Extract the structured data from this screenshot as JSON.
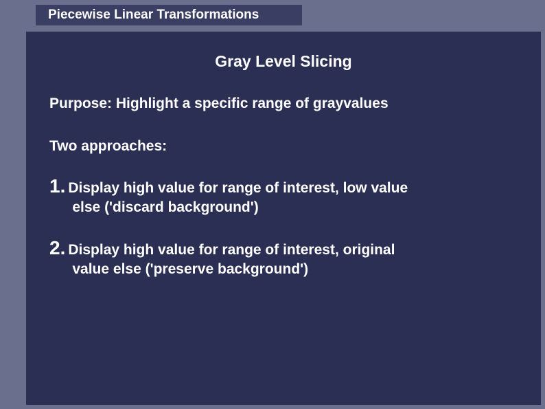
{
  "title": "Piecewise Linear Transformations",
  "subtitle": "Gray Level Slicing",
  "purpose": "Purpose: Highlight a specific range of grayvalues",
  "approaches_label": "Two approaches:",
  "items": [
    {
      "num": "1.",
      "line1": "Display high value for range of interest, low value",
      "line2": "else ('discard background')"
    },
    {
      "num": "2.",
      "line1": "Display high value for range of interest, original",
      "line2": "value else ('preserve background')"
    }
  ]
}
